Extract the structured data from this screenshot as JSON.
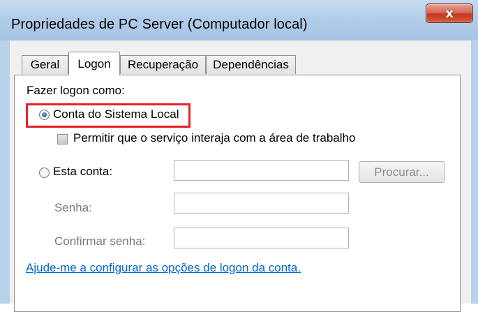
{
  "window": {
    "title": "Propriedades de PC Server (Computador local)",
    "close_glyph": "x"
  },
  "tabs": [
    {
      "label": "Geral"
    },
    {
      "label": "Logon"
    },
    {
      "label": "Recuperação"
    },
    {
      "label": "Dependências"
    }
  ],
  "logon": {
    "group_label": "Fazer logon como:",
    "local_system_label": "Conta do Sistema Local",
    "interact_desktop_label": "Permitir que o serviço interaja com a área de trabalho",
    "this_account_label": "Esta conta:",
    "account_value": "",
    "browse_label": "Procurar...",
    "password_label": "Senha:",
    "password_value": "",
    "confirm_password_label": "Confirmar senha:",
    "confirm_password_value": "",
    "help_link": "Ajude-me a configurar as opções de logon da conta."
  },
  "colors": {
    "highlight": "#e8202a",
    "link": "#0066cc",
    "titlebar": "#b9d1ea"
  }
}
